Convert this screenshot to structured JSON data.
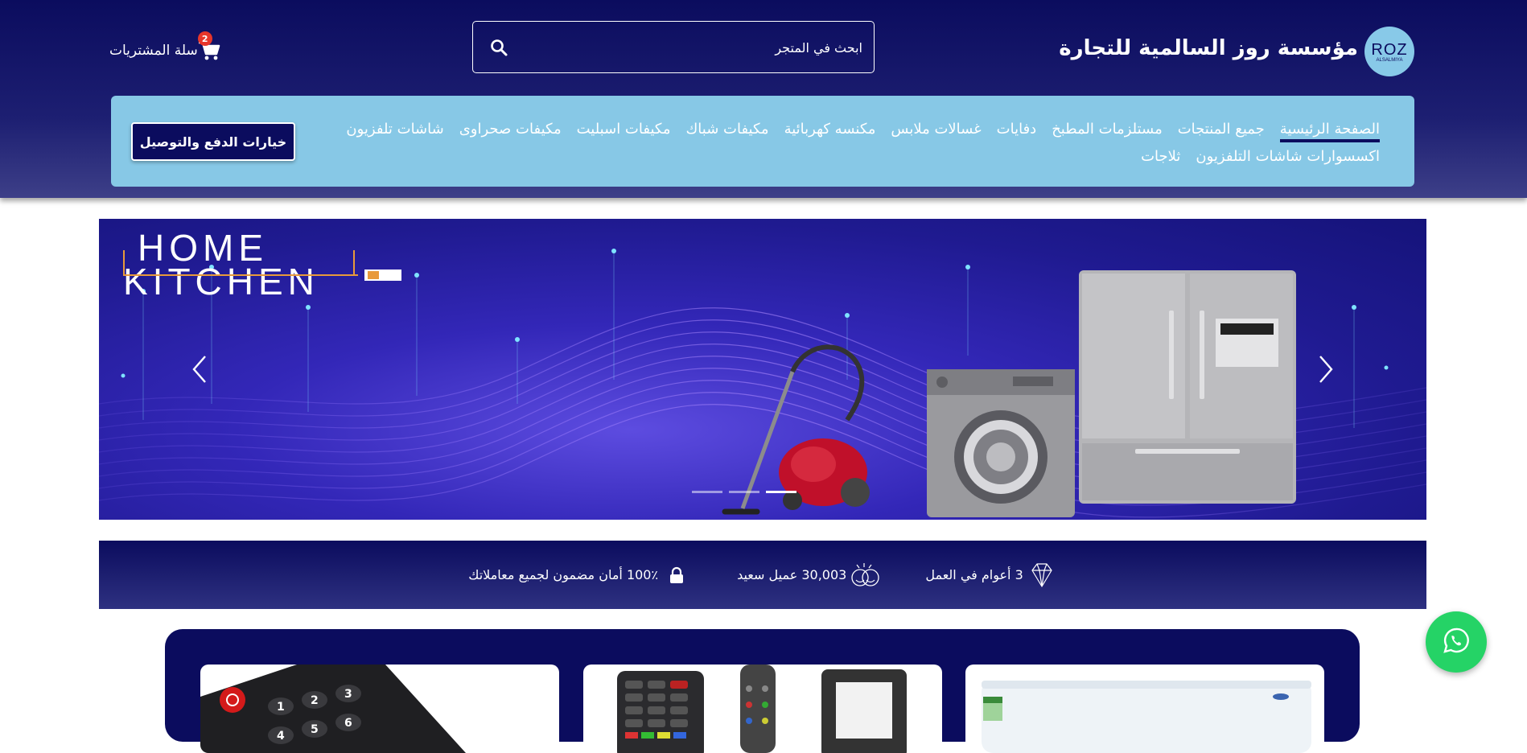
{
  "header": {
    "brand_title": "مؤسسة روز السالمية للتجارة",
    "logo_main": "ROZ",
    "logo_sub": "ALSALMIYA",
    "search_placeholder": "ابحث في المتجر",
    "cart_label": "سلة المشتريات",
    "cart_count": "2",
    "colors": {
      "bg": "#0b0c5e",
      "nav_bg": "#87c8e6",
      "badge": "#e8362b"
    }
  },
  "nav": {
    "links": [
      "الصفحة الرئيسية",
      "جميع المنتجات",
      "مستلزمات المطبخ",
      "دفايات",
      "غسالات ملابس",
      "مكنسه كهربائية",
      "مكيفات شباك",
      "مكيفات اسبليت",
      "مكيفات صحراوى",
      "شاشات تلفزيون",
      "اكسسوارات شاشات التلفزيون",
      "ثلاجات"
    ],
    "active_index": 0,
    "pay_button": "خيارات الدفع والتوصيل"
  },
  "hero": {
    "logo_line1": "HOME",
    "logo_line2": "KITCHEN",
    "slide_count": 3,
    "active_slide": 2
  },
  "features": [
    {
      "icon": "diamond-icon",
      "text": "3 أعوام في العمل"
    },
    {
      "icon": "happy-faces-icon",
      "text": "30,003 عميل سعيد"
    },
    {
      "icon": "lock-icon",
      "text": "100٪ أمان مضمون لجميع معاملاتك"
    }
  ],
  "products": {
    "cards": [
      {
        "icon": "split-ac-icon"
      },
      {
        "icon": "remote-controls-icon"
      },
      {
        "icon": "tv-remote-icon"
      }
    ]
  },
  "whatsapp": {
    "icon": "whatsapp-icon",
    "color": "#25d366"
  }
}
